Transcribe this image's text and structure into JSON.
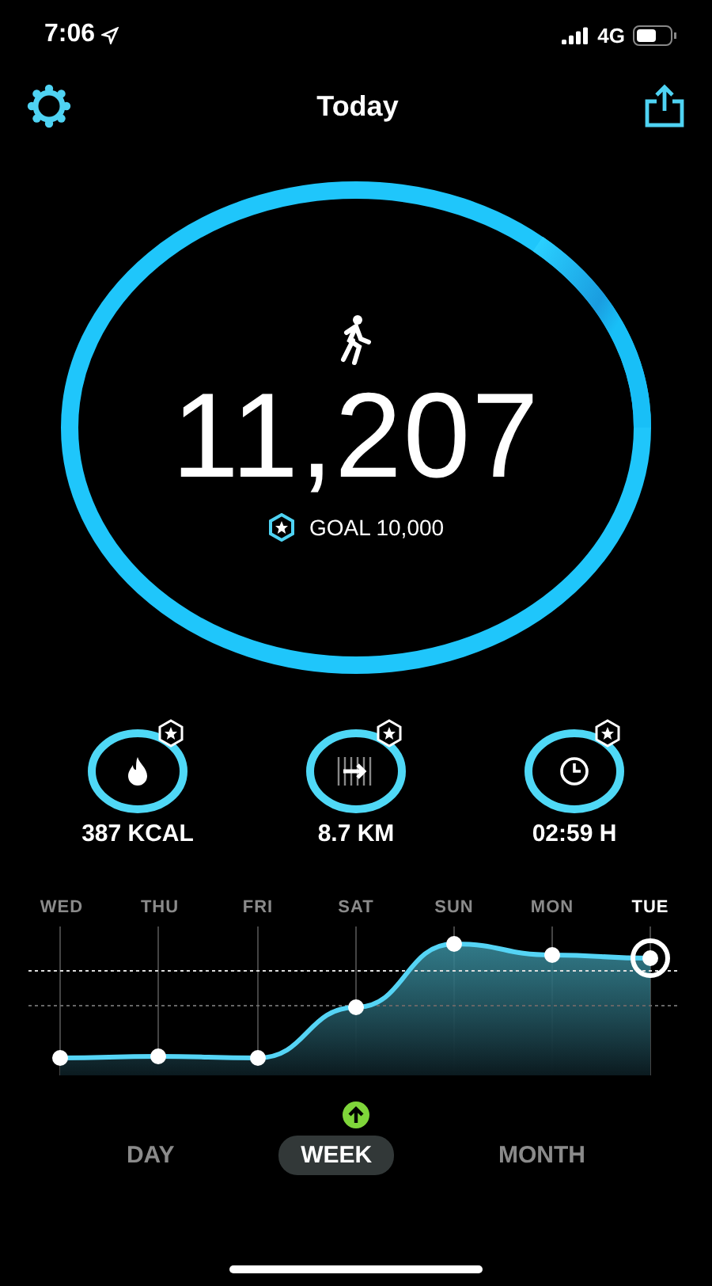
{
  "status_bar": {
    "time": "7:06",
    "network": "4G"
  },
  "header": {
    "title": "Today"
  },
  "steps": {
    "count": "11,207",
    "goal": "GOAL 10,000"
  },
  "stats": [
    {
      "kind": "calories",
      "value": "387 KCAL"
    },
    {
      "kind": "distance",
      "value": "8.7 KM"
    },
    {
      "kind": "duration",
      "value": "02:59 H"
    }
  ],
  "days": [
    {
      "label": "WED",
      "selected": false
    },
    {
      "label": "THU",
      "selected": false
    },
    {
      "label": "FRI",
      "selected": false
    },
    {
      "label": "SAT",
      "selected": false
    },
    {
      "label": "SUN",
      "selected": false
    },
    {
      "label": "MON",
      "selected": false
    },
    {
      "label": "TUE",
      "selected": true
    }
  ],
  "periods": [
    {
      "label": "DAY",
      "selected": false
    },
    {
      "label": "WEEK",
      "selected": true
    },
    {
      "label": "MONTH",
      "selected": false
    }
  ]
}
